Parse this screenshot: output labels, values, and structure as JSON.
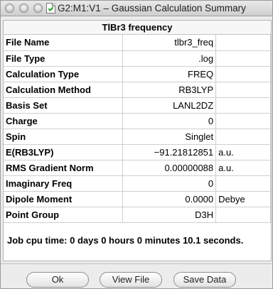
{
  "window": {
    "title": "G2:M1:V1 – Gaussian Calculation Summary"
  },
  "summary": {
    "title": "TlBr3 frequency",
    "rows": [
      {
        "label": "File Name",
        "value": "tlbr3_freq",
        "unit": ""
      },
      {
        "label": "File Type",
        "value": ".log",
        "unit": ""
      },
      {
        "label": "Calculation Type",
        "value": "FREQ",
        "unit": ""
      },
      {
        "label": "Calculation Method",
        "value": "RB3LYP",
        "unit": ""
      },
      {
        "label": "Basis Set",
        "value": "LANL2DZ",
        "unit": ""
      },
      {
        "label": "Charge",
        "value": "0",
        "unit": ""
      },
      {
        "label": "Spin",
        "value": "Singlet",
        "unit": ""
      },
      {
        "label": "E(RB3LYP)",
        "value": "−91.21812851",
        "unit": "a.u."
      },
      {
        "label": "RMS Gradient Norm",
        "value": "0.00000088",
        "unit": "a.u."
      },
      {
        "label": "Imaginary Freq",
        "value": "0",
        "unit": ""
      },
      {
        "label": "Dipole Moment",
        "value": "0.0000",
        "unit": "Debye"
      },
      {
        "label": "Point Group",
        "value": "D3H",
        "unit": ""
      }
    ],
    "cpu_time": "Job cpu time:  0 days  0 hours  0 minutes 10.1 seconds."
  },
  "buttons": {
    "ok": "Ok",
    "view_file": "View File",
    "save_data": "Save Data"
  },
  "icons": {
    "close": "close-button-icon",
    "minimize": "minimize-button-icon",
    "zoom": "zoom-button-icon",
    "document": "document-icon"
  }
}
